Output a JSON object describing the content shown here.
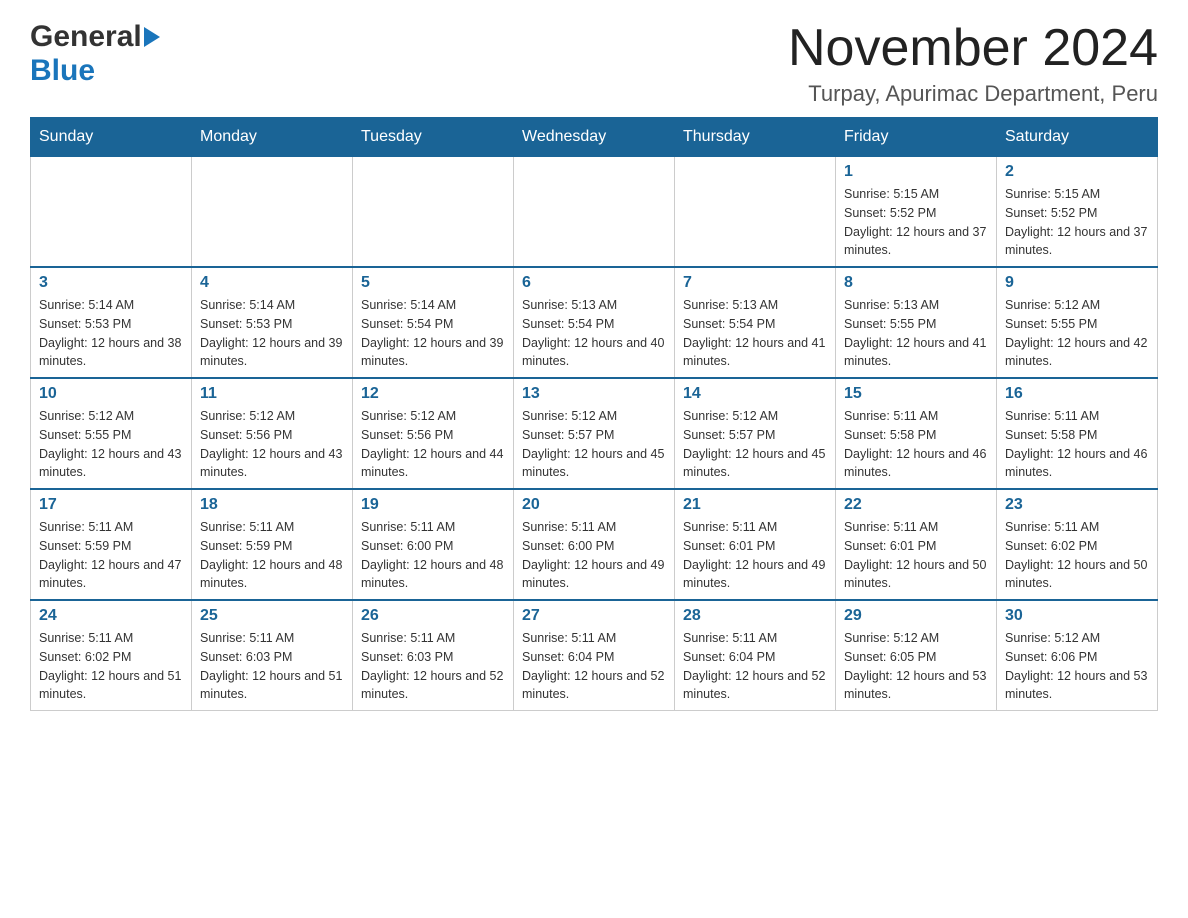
{
  "header": {
    "logo_general": "General",
    "logo_blue": "Blue",
    "month_title": "November 2024",
    "location": "Turpay, Apurimac Department, Peru"
  },
  "weekdays": [
    "Sunday",
    "Monday",
    "Tuesday",
    "Wednesday",
    "Thursday",
    "Friday",
    "Saturday"
  ],
  "weeks": [
    {
      "days": [
        {
          "num": "",
          "sunrise": "",
          "sunset": "",
          "daylight": ""
        },
        {
          "num": "",
          "sunrise": "",
          "sunset": "",
          "daylight": ""
        },
        {
          "num": "",
          "sunrise": "",
          "sunset": "",
          "daylight": ""
        },
        {
          "num": "",
          "sunrise": "",
          "sunset": "",
          "daylight": ""
        },
        {
          "num": "",
          "sunrise": "",
          "sunset": "",
          "daylight": ""
        },
        {
          "num": "1",
          "sunrise": "Sunrise: 5:15 AM",
          "sunset": "Sunset: 5:52 PM",
          "daylight": "Daylight: 12 hours and 37 minutes."
        },
        {
          "num": "2",
          "sunrise": "Sunrise: 5:15 AM",
          "sunset": "Sunset: 5:52 PM",
          "daylight": "Daylight: 12 hours and 37 minutes."
        }
      ]
    },
    {
      "days": [
        {
          "num": "3",
          "sunrise": "Sunrise: 5:14 AM",
          "sunset": "Sunset: 5:53 PM",
          "daylight": "Daylight: 12 hours and 38 minutes."
        },
        {
          "num": "4",
          "sunrise": "Sunrise: 5:14 AM",
          "sunset": "Sunset: 5:53 PM",
          "daylight": "Daylight: 12 hours and 39 minutes."
        },
        {
          "num": "5",
          "sunrise": "Sunrise: 5:14 AM",
          "sunset": "Sunset: 5:54 PM",
          "daylight": "Daylight: 12 hours and 39 minutes."
        },
        {
          "num": "6",
          "sunrise": "Sunrise: 5:13 AM",
          "sunset": "Sunset: 5:54 PM",
          "daylight": "Daylight: 12 hours and 40 minutes."
        },
        {
          "num": "7",
          "sunrise": "Sunrise: 5:13 AM",
          "sunset": "Sunset: 5:54 PM",
          "daylight": "Daylight: 12 hours and 41 minutes."
        },
        {
          "num": "8",
          "sunrise": "Sunrise: 5:13 AM",
          "sunset": "Sunset: 5:55 PM",
          "daylight": "Daylight: 12 hours and 41 minutes."
        },
        {
          "num": "9",
          "sunrise": "Sunrise: 5:12 AM",
          "sunset": "Sunset: 5:55 PM",
          "daylight": "Daylight: 12 hours and 42 minutes."
        }
      ]
    },
    {
      "days": [
        {
          "num": "10",
          "sunrise": "Sunrise: 5:12 AM",
          "sunset": "Sunset: 5:55 PM",
          "daylight": "Daylight: 12 hours and 43 minutes."
        },
        {
          "num": "11",
          "sunrise": "Sunrise: 5:12 AM",
          "sunset": "Sunset: 5:56 PM",
          "daylight": "Daylight: 12 hours and 43 minutes."
        },
        {
          "num": "12",
          "sunrise": "Sunrise: 5:12 AM",
          "sunset": "Sunset: 5:56 PM",
          "daylight": "Daylight: 12 hours and 44 minutes."
        },
        {
          "num": "13",
          "sunrise": "Sunrise: 5:12 AM",
          "sunset": "Sunset: 5:57 PM",
          "daylight": "Daylight: 12 hours and 45 minutes."
        },
        {
          "num": "14",
          "sunrise": "Sunrise: 5:12 AM",
          "sunset": "Sunset: 5:57 PM",
          "daylight": "Daylight: 12 hours and 45 minutes."
        },
        {
          "num": "15",
          "sunrise": "Sunrise: 5:11 AM",
          "sunset": "Sunset: 5:58 PM",
          "daylight": "Daylight: 12 hours and 46 minutes."
        },
        {
          "num": "16",
          "sunrise": "Sunrise: 5:11 AM",
          "sunset": "Sunset: 5:58 PM",
          "daylight": "Daylight: 12 hours and 46 minutes."
        }
      ]
    },
    {
      "days": [
        {
          "num": "17",
          "sunrise": "Sunrise: 5:11 AM",
          "sunset": "Sunset: 5:59 PM",
          "daylight": "Daylight: 12 hours and 47 minutes."
        },
        {
          "num": "18",
          "sunrise": "Sunrise: 5:11 AM",
          "sunset": "Sunset: 5:59 PM",
          "daylight": "Daylight: 12 hours and 48 minutes."
        },
        {
          "num": "19",
          "sunrise": "Sunrise: 5:11 AM",
          "sunset": "Sunset: 6:00 PM",
          "daylight": "Daylight: 12 hours and 48 minutes."
        },
        {
          "num": "20",
          "sunrise": "Sunrise: 5:11 AM",
          "sunset": "Sunset: 6:00 PM",
          "daylight": "Daylight: 12 hours and 49 minutes."
        },
        {
          "num": "21",
          "sunrise": "Sunrise: 5:11 AM",
          "sunset": "Sunset: 6:01 PM",
          "daylight": "Daylight: 12 hours and 49 minutes."
        },
        {
          "num": "22",
          "sunrise": "Sunrise: 5:11 AM",
          "sunset": "Sunset: 6:01 PM",
          "daylight": "Daylight: 12 hours and 50 minutes."
        },
        {
          "num": "23",
          "sunrise": "Sunrise: 5:11 AM",
          "sunset": "Sunset: 6:02 PM",
          "daylight": "Daylight: 12 hours and 50 minutes."
        }
      ]
    },
    {
      "days": [
        {
          "num": "24",
          "sunrise": "Sunrise: 5:11 AM",
          "sunset": "Sunset: 6:02 PM",
          "daylight": "Daylight: 12 hours and 51 minutes."
        },
        {
          "num": "25",
          "sunrise": "Sunrise: 5:11 AM",
          "sunset": "Sunset: 6:03 PM",
          "daylight": "Daylight: 12 hours and 51 minutes."
        },
        {
          "num": "26",
          "sunrise": "Sunrise: 5:11 AM",
          "sunset": "Sunset: 6:03 PM",
          "daylight": "Daylight: 12 hours and 52 minutes."
        },
        {
          "num": "27",
          "sunrise": "Sunrise: 5:11 AM",
          "sunset": "Sunset: 6:04 PM",
          "daylight": "Daylight: 12 hours and 52 minutes."
        },
        {
          "num": "28",
          "sunrise": "Sunrise: 5:11 AM",
          "sunset": "Sunset: 6:04 PM",
          "daylight": "Daylight: 12 hours and 52 minutes."
        },
        {
          "num": "29",
          "sunrise": "Sunrise: 5:12 AM",
          "sunset": "Sunset: 6:05 PM",
          "daylight": "Daylight: 12 hours and 53 minutes."
        },
        {
          "num": "30",
          "sunrise": "Sunrise: 5:12 AM",
          "sunset": "Sunset: 6:06 PM",
          "daylight": "Daylight: 12 hours and 53 minutes."
        }
      ]
    }
  ]
}
